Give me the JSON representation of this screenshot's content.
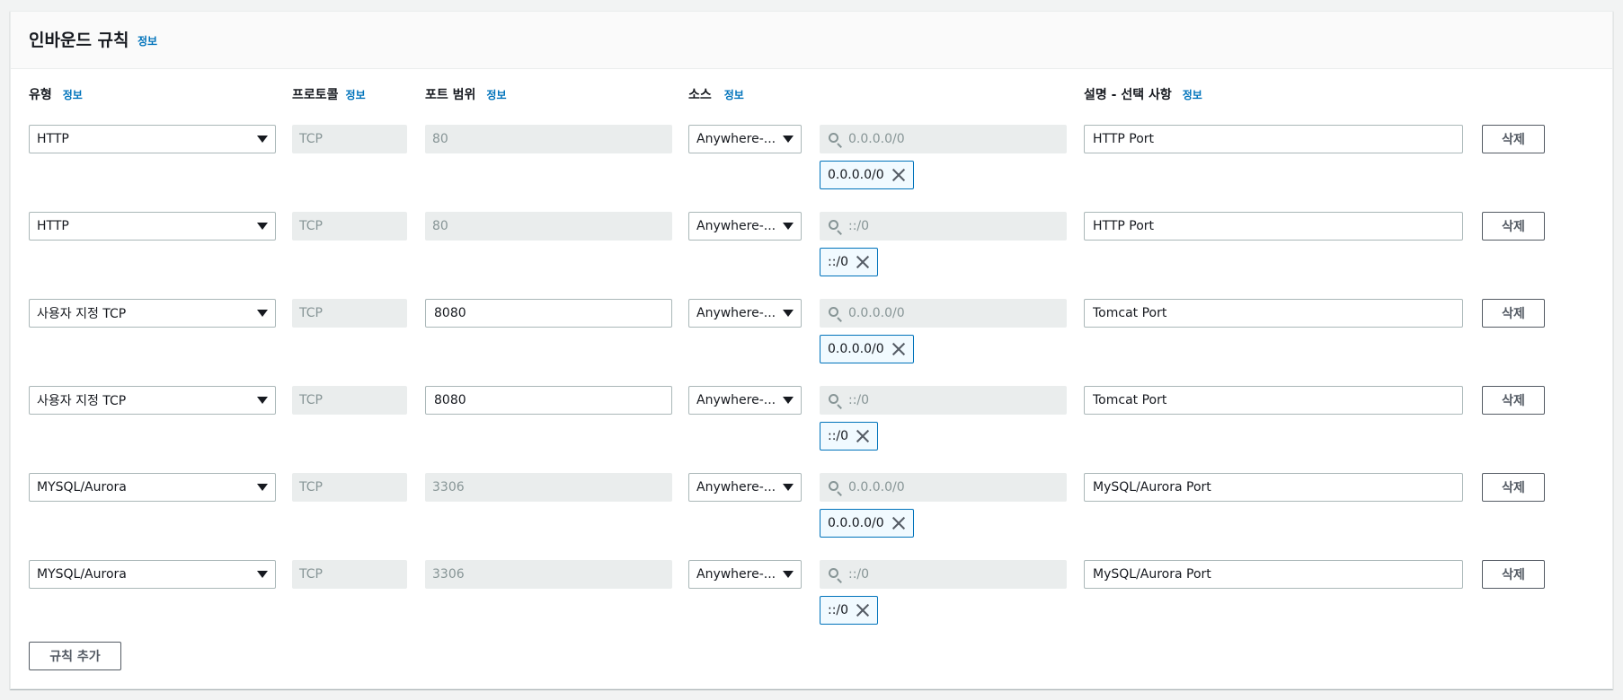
{
  "panel": {
    "title": "인바운드 규칙",
    "info": "정보"
  },
  "columns": {
    "type": "유형",
    "protocol": "프로토콜",
    "port_range": "포트 범위",
    "source": "소스",
    "description": "설명 - 선택 사항",
    "info": "정보"
  },
  "rules": [
    {
      "type": "HTTP",
      "protocol": "TCP",
      "port": "80",
      "port_editable": false,
      "source": "Anywhere-...",
      "search_placeholder": "0.0.0.0/0",
      "cidr": "0.0.0.0/0",
      "description": "HTTP Port",
      "delete_label": "삭제"
    },
    {
      "type": "HTTP",
      "protocol": "TCP",
      "port": "80",
      "port_editable": false,
      "source": "Anywhere-...",
      "search_placeholder": "::/0",
      "cidr": "::/0",
      "description": "HTTP Port",
      "delete_label": "삭제"
    },
    {
      "type": "사용자 지정 TCP",
      "protocol": "TCP",
      "port": "8080",
      "port_editable": true,
      "source": "Anywhere-...",
      "search_placeholder": "0.0.0.0/0",
      "cidr": "0.0.0.0/0",
      "description": "Tomcat Port",
      "delete_label": "삭제"
    },
    {
      "type": "사용자 지정 TCP",
      "protocol": "TCP",
      "port": "8080",
      "port_editable": true,
      "source": "Anywhere-...",
      "search_placeholder": "::/0",
      "cidr": "::/0",
      "description": "Tomcat Port",
      "delete_label": "삭제"
    },
    {
      "type": "MYSQL/Aurora",
      "protocol": "TCP",
      "port": "3306",
      "port_editable": false,
      "source": "Anywhere-...",
      "search_placeholder": "0.0.0.0/0",
      "cidr": "0.0.0.0/0",
      "description": "MySQL/Aurora Port",
      "delete_label": "삭제"
    },
    {
      "type": "MYSQL/Aurora",
      "protocol": "TCP",
      "port": "3306",
      "port_editable": false,
      "source": "Anywhere-...",
      "search_placeholder": "::/0",
      "cidr": "::/0",
      "description": "MySQL/Aurora Port",
      "delete_label": "삭제"
    }
  ],
  "add_rule_label": "규칙 추가",
  "icons": {
    "dropdown": "caret-down-icon",
    "search": "search-icon",
    "remove": "close-icon"
  },
  "colors": {
    "link": "#0073bb",
    "token_border": "#0073bb",
    "disabled_bg": "#eaeded"
  }
}
